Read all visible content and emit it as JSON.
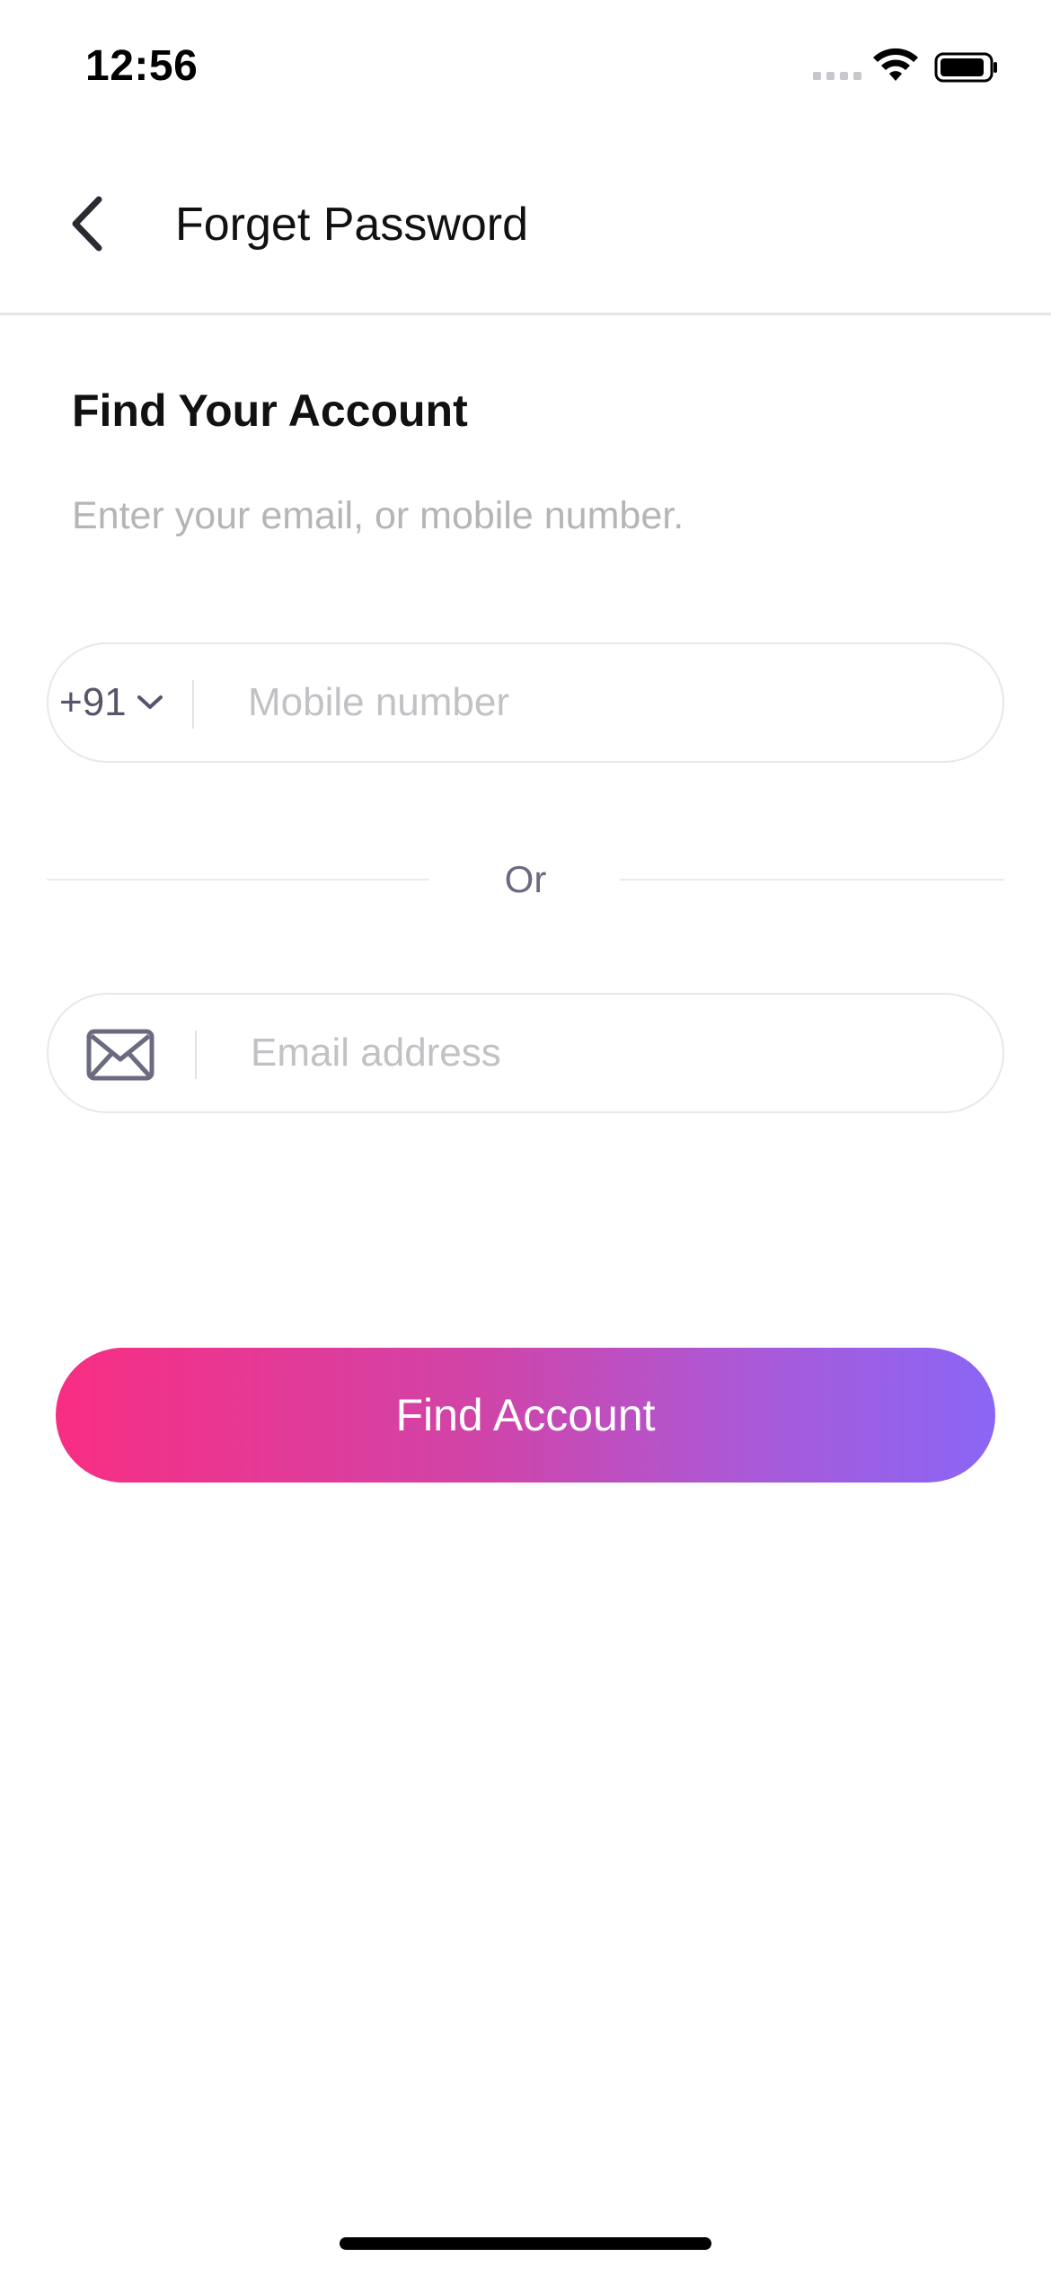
{
  "status_bar": {
    "time": "12:56",
    "signal_icon": "cellular-signal-icon",
    "wifi_icon": "wifi-icon",
    "battery_icon": "battery-icon"
  },
  "header": {
    "back_icon": "chevron-left-icon",
    "title": "Forget Password"
  },
  "content": {
    "title": "Find Your Account",
    "subtitle": "Enter your email, or mobile number."
  },
  "phone_field": {
    "country_code": "+91",
    "dropdown_icon": "chevron-down-icon",
    "placeholder": "Mobile number",
    "value": ""
  },
  "separator": {
    "label": "Or"
  },
  "email_field": {
    "icon": "mail-icon",
    "placeholder": "Email address",
    "value": ""
  },
  "actions": {
    "find_account_label": "Find Account"
  },
  "colors": {
    "gradient_start": "#f82e83",
    "gradient_end": "#8a66f5",
    "placeholder": "#c2c2c6",
    "secondary_text": "#6b6b80"
  }
}
